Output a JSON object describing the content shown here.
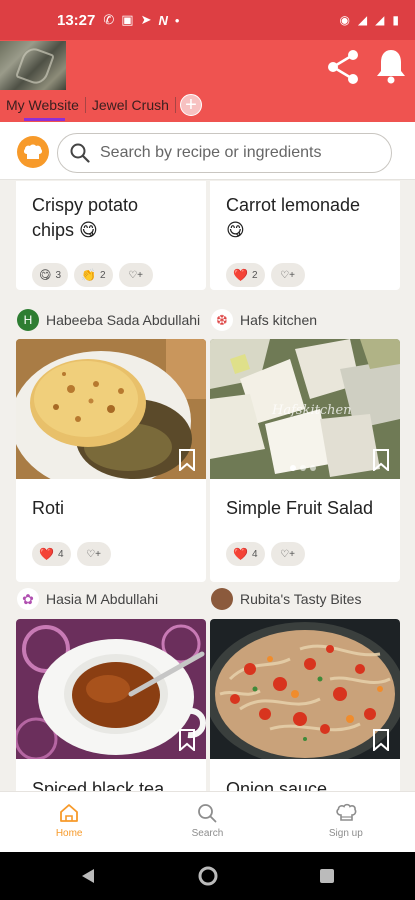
{
  "status_bar": {
    "time": "13:27",
    "notif_icons": [
      "whatsapp-icon",
      "news-icon",
      "telegram-icon",
      "n-app-icon",
      "dot-icon"
    ],
    "system_icons": [
      "eye-icon",
      "signal-icon",
      "signal-icon",
      "battery-icon"
    ]
  },
  "browser_tabs": [
    {
      "label": "My Website",
      "active": true
    },
    {
      "label": "Jewel Crush",
      "active": false
    }
  ],
  "search": {
    "placeholder": "Search by recipe or ingredients"
  },
  "feed": {
    "top_cards": [
      {
        "title_line1": "Crispy potato",
        "title_line2": "chips 😋",
        "reactions": [
          {
            "emoji": "😋",
            "count": "3"
          },
          {
            "emoji": "👏",
            "count": "2"
          }
        ]
      },
      {
        "title_line1": "Carrot lemonade",
        "title_line2": "😋",
        "reactions": [
          {
            "emoji": "❤️",
            "count": "2"
          }
        ]
      }
    ],
    "authors_row1": [
      {
        "initial": "H",
        "name": "Habeeba Sada Abdullahi"
      },
      {
        "name": "Hafs kitchen"
      }
    ],
    "mid_cards": [
      {
        "title": "Roti",
        "reactions": [
          {
            "emoji": "❤️",
            "count": "4"
          }
        ]
      },
      {
        "title": "Simple Fruit Salad",
        "photo_watermark": "Hafskitchen",
        "reactions": [
          {
            "emoji": "❤️",
            "count": "4"
          }
        ]
      }
    ],
    "authors_row2": [
      {
        "name": "Hasia M Abdullahi"
      },
      {
        "name": "Rubita's Tasty Bites"
      }
    ],
    "bottom_cards": [
      {
        "title": "Spiced black tea"
      },
      {
        "title": "Onion sauce"
      }
    ]
  },
  "bottom_nav": [
    {
      "label": "Home",
      "icon": "home-icon",
      "active": true
    },
    {
      "label": "Search",
      "icon": "search-icon",
      "active": false
    },
    {
      "label": "Sign up",
      "icon": "chef-hat-icon",
      "active": false
    }
  ],
  "colors": {
    "status_bar": "#dd3f43",
    "header": "#ef5350",
    "accent": "#f79a2a",
    "tab_underline": "#8e2fd6"
  }
}
